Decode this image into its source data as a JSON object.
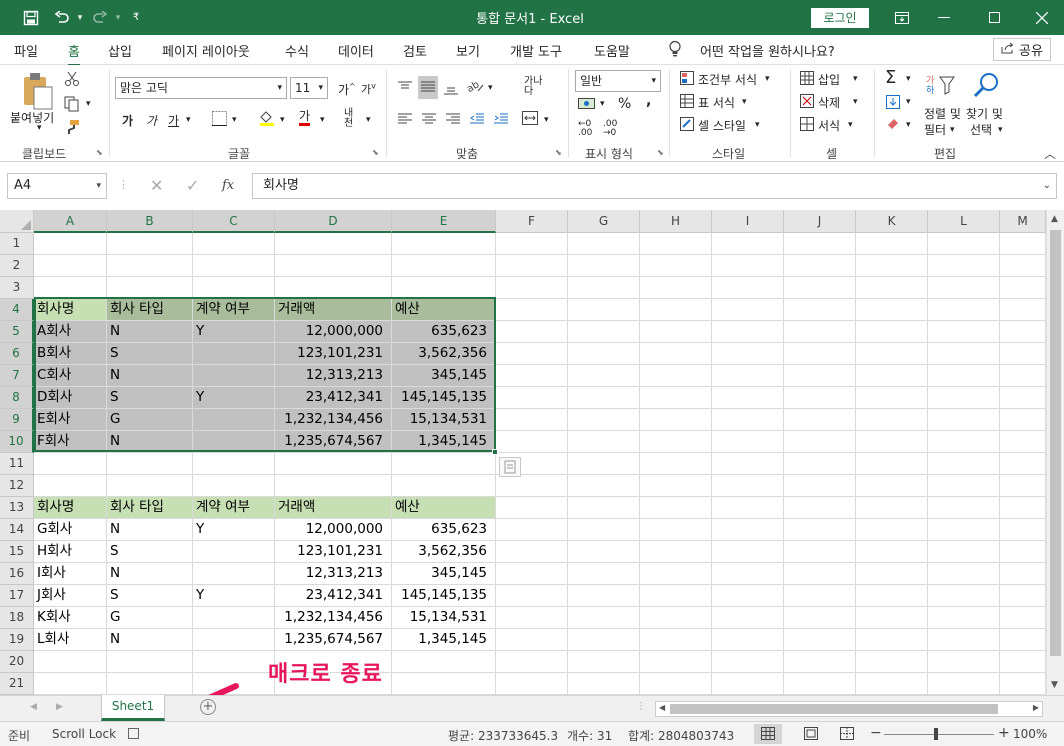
{
  "titlebar": {
    "title": "통합 문서1  -  Excel",
    "login_label": "로그인"
  },
  "tabs": [
    "파일",
    "홈",
    "삽입",
    "페이지 레이아웃",
    "수식",
    "데이터",
    "검토",
    "보기",
    "개발 도구",
    "도움말"
  ],
  "tell_me": "어떤 작업을 원하시나요?",
  "share_label": "공유",
  "ribbon": {
    "clipboard": {
      "paste": "붙여넣기",
      "group": "클립보드"
    },
    "font": {
      "name": "맑은 고딕",
      "size": "11",
      "group": "글꼴",
      "bold": "가",
      "italic": "가",
      "underline": "가",
      "color_label": "가",
      "phonetic": "내천"
    },
    "alignment": {
      "group": "맞춤"
    },
    "number": {
      "format": "일반",
      "group": "표시 형식",
      "percent": "%",
      "comma": ","
    },
    "styles": {
      "conditional": "조건부 서식",
      "table": "표 서식",
      "cell": "셀 스타일",
      "group": "스타일"
    },
    "cells": {
      "insert": "삽입",
      "delete": "삭제",
      "format": "서식",
      "group": "셀"
    },
    "editing": {
      "sort": "정렬 및 필터",
      "find": "찾기 및 선택",
      "group": "편집",
      "sort1": "정렬 및",
      "sort2": "필터",
      "find1": "찾기 및",
      "find2": "선택"
    }
  },
  "formula_bar": {
    "name_box": "A4",
    "fx": "fx",
    "content": "회사명"
  },
  "columns": [
    "A",
    "B",
    "C",
    "D",
    "E",
    "F",
    "G",
    "H",
    "I",
    "J",
    "K",
    "L",
    "M"
  ],
  "rows": [
    "1",
    "2",
    "3",
    "4",
    "5",
    "6",
    "7",
    "8",
    "9",
    "10",
    "11",
    "12",
    "13",
    "14",
    "15",
    "16",
    "17",
    "18",
    "19",
    "20",
    "21"
  ],
  "table1": {
    "headers": [
      "회사명",
      "회사 타입",
      "계약 여부",
      "거래액",
      "예산"
    ],
    "rows": [
      [
        "A회사",
        "N",
        "Y",
        "12,000,000",
        "635,623"
      ],
      [
        "B회사",
        "S",
        "",
        "123,101,231",
        "3,562,356"
      ],
      [
        "C회사",
        "N",
        "",
        "12,313,213",
        "345,145"
      ],
      [
        "D회사",
        "S",
        "Y",
        "23,412,341",
        "145,145,135"
      ],
      [
        "E회사",
        "G",
        "",
        "1,232,134,456",
        "15,134,531"
      ],
      [
        "F회사",
        "N",
        "",
        "1,235,674,567",
        "1,345,145"
      ]
    ]
  },
  "table2": {
    "headers": [
      "회사명",
      "회사 타입",
      "계약 여부",
      "거래액",
      "예산"
    ],
    "rows": [
      [
        "G회사",
        "N",
        "Y",
        "12,000,000",
        "635,623"
      ],
      [
        "H회사",
        "S",
        "",
        "123,101,231",
        "3,562,356"
      ],
      [
        "I회사",
        "N",
        "",
        "12,313,213",
        "345,145"
      ],
      [
        "J회사",
        "S",
        "Y",
        "23,412,341",
        "145,145,135"
      ],
      [
        "K회사",
        "G",
        "",
        "1,232,134,456",
        "15,134,531"
      ],
      [
        "L회사",
        "N",
        "",
        "1,235,674,567",
        "1,345,145"
      ]
    ]
  },
  "annotation": "매크로 종료",
  "sheet_tab": "Sheet1",
  "status": {
    "ready": "준비",
    "scroll_lock": "Scroll Lock",
    "average": "평균: 233733645.3",
    "count": "개수: 31",
    "sum": "합계: 2804803743",
    "zoom": "100%"
  },
  "colors": {
    "accent": "#217346",
    "header_fill": "#c6e0b4",
    "annotation": "#e8175d"
  }
}
